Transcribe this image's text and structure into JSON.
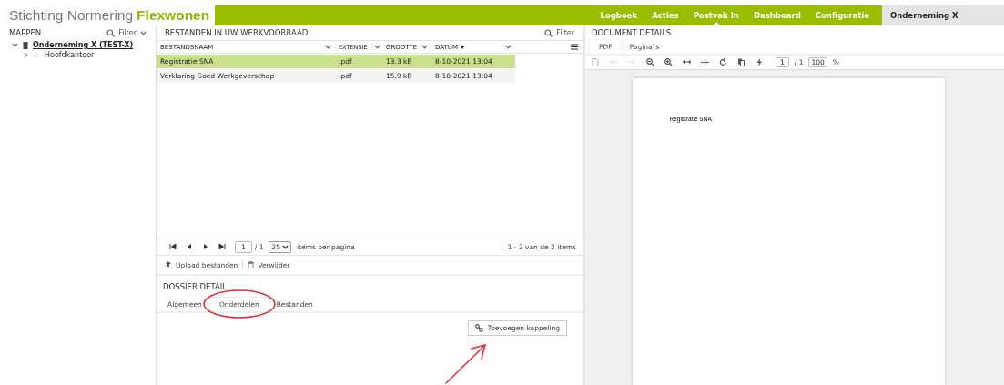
{
  "header": {
    "logo_prefix": "Stichting Normering",
    "logo_accent": "Flexwonen",
    "nav": [
      {
        "label": "Logboek",
        "selected": false
      },
      {
        "label": "Acties",
        "selected": false
      },
      {
        "label": "Postvak In",
        "selected": true
      },
      {
        "label": "Dashboard",
        "selected": false
      },
      {
        "label": "Configuratie",
        "selected": false
      }
    ],
    "account": "Onderneming X"
  },
  "folders": {
    "title": "MAPPEN",
    "filter": "Filter",
    "tree": [
      {
        "label": "Onderneming X (TEST-X)",
        "expanded": true,
        "children": [
          {
            "label": "Hoofdkantoor",
            "expanded": false
          }
        ]
      }
    ]
  },
  "files": {
    "title": "BESTANDEN IN UW WERKVOORRAAD",
    "filter": "Filter",
    "columns": [
      "BESTANDSNAAM",
      "EXTENSIE",
      "GROOTTE",
      "DATUM"
    ],
    "rows": [
      {
        "cells": [
          "Registratie SNA",
          ".pdf",
          "13.3 kB",
          "8-10-2021 13:04"
        ],
        "selected": true
      },
      {
        "cells": [
          "Verklaring Goed Werkgeverschap",
          ".pdf",
          "15.9 kB",
          "8-10-2021 13:04"
        ],
        "selected": false
      }
    ],
    "pager": {
      "page": "1",
      "total": "/ 1",
      "page_size": "25",
      "per_page": "items per pagina",
      "summary": "1 - 2 van de 2 items"
    },
    "actions": [
      "Upload bestanden",
      "Verwijder"
    ]
  },
  "dossier": {
    "title": "DOSSIER DETAIL",
    "tabs": [
      {
        "label": "Algemeen",
        "selected": false,
        "circled": false
      },
      {
        "label": "Onderdelen",
        "selected": true,
        "circled": true
      },
      {
        "label": "Bestanden",
        "selected": false,
        "circled": false
      }
    ],
    "button": "Toevoegen koppeling",
    "button_arrow": true
  },
  "document": {
    "title": "DOCUMENT DETAILS",
    "tabs": [
      {
        "label": "PDF",
        "selected": true
      },
      {
        "label": "Pagina`s",
        "selected": false
      }
    ],
    "page": "1",
    "total": "/ 1",
    "zoom": "100",
    "zoom_unit": "%",
    "page_text": "Registratie SNA"
  }
}
